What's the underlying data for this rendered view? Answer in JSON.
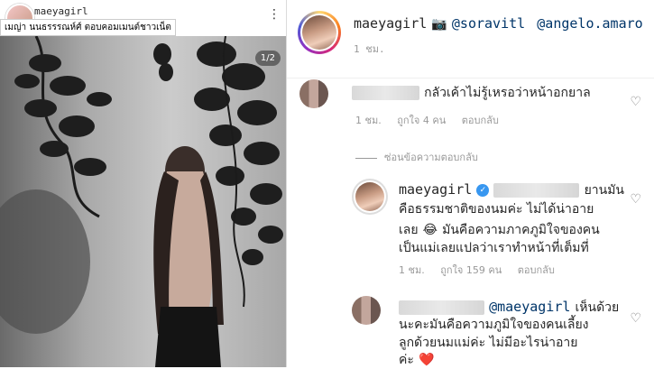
{
  "left": {
    "username": "maeyagirl",
    "caption_strip": "เมญ่า นนธรรรณห์ศ์ ตอบคอมเมนต์ชาวเน็ต",
    "photo_badge": "1/2",
    "more_icon": "more-dots-icon"
  },
  "header": {
    "username": "maeyagirl",
    "camera_icon": "camera-icon",
    "mention1": "@soravitl",
    "mention2": "@angelo.amaro",
    "time": "1 ชม."
  },
  "comments": [
    {
      "text": "กลัวเค้าไม่รู้เหรอว่าหน้าอกยาล",
      "time": "1 ชม.",
      "likes": "ถูกใจ 4 คน",
      "reply": "ตอบกลับ"
    }
  ],
  "hide_replies": "ซ่อนข้อความตอบกลับ",
  "reply_comment": {
    "username": "maeyagirl",
    "verified_icon": "verified-badge-icon",
    "line1": "ยานมัน",
    "line2": "คือธรรมชาติของนมค่ะ ไม่ได้น่าอาย",
    "line3a": "เลย",
    "emoji": "😂",
    "line3b": "มันคือความภาคภูมิใจของคน",
    "line4": "เป็นแม่เลยแปลว่าเราทำหน้าที่เต็มที่",
    "time": "1 ชม.",
    "likes": "ถูกใจ 159 คน",
    "reply": "ตอบกลับ"
  },
  "last_comment": {
    "mention": "@maeyagirl",
    "line1": "เห็นด้วย",
    "line2": "นะคะมันคือความภูมิใจของคนเลี้ยง",
    "line3": "ลูกด้วยนมแม่ค่ะ ไม่มีอะไรน่าอาย",
    "line4": "ค่ะ",
    "heart_emoji": "❤️"
  }
}
